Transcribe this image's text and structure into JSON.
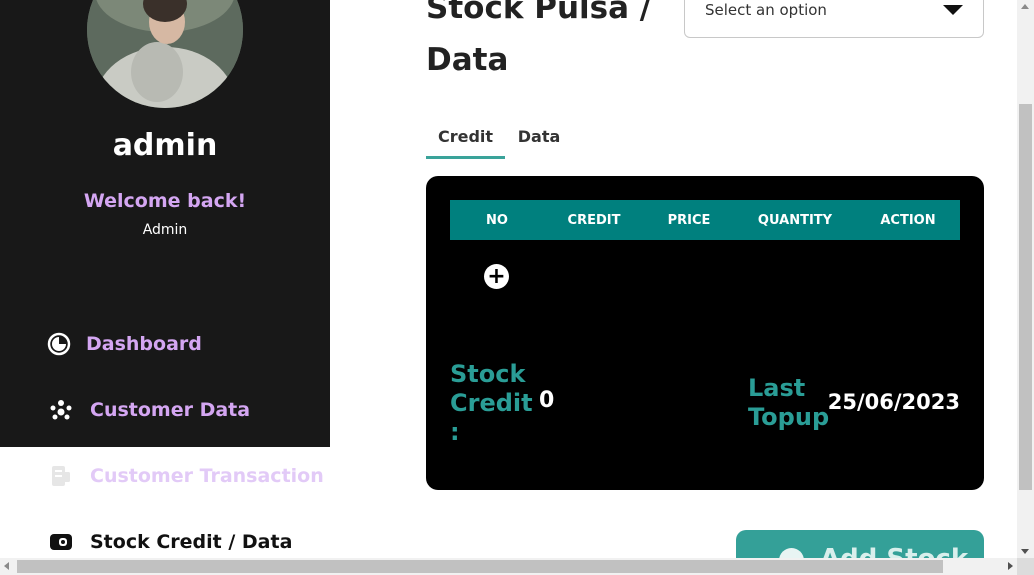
{
  "sidebar": {
    "username": "admin",
    "welcome": "Welcome back!",
    "role": "Admin",
    "items": [
      {
        "label": "Dashboard",
        "icon": "dashboard-icon"
      },
      {
        "label": "Customer Data",
        "icon": "customers-icon"
      },
      {
        "label": "Customer Transaction",
        "icon": "receipt-icon"
      },
      {
        "label": "Stock Credit / Data",
        "icon": "wallet-icon"
      }
    ]
  },
  "main": {
    "title_line1": "Stock Pulsa /",
    "title_line2": "Data",
    "select_placeholder": "Select an option",
    "tabs": [
      {
        "label": "Credit",
        "active": true
      },
      {
        "label": "Data",
        "active": false
      }
    ],
    "table": {
      "headers": [
        "NO",
        "CREDIT",
        "PRICE",
        "QUANTITY",
        "ACTION"
      ],
      "add_row_symbol": "+"
    },
    "stock_credit_label": "Stock Credit :",
    "stock_credit_value": "0",
    "last_topup_label": "Last Topup",
    "last_topup_value": "25/06/2023",
    "add_stock_label": "Add Stock"
  },
  "colors": {
    "accent": "#34a098",
    "table_header": "#00807e",
    "sidebar_bg": "#181818",
    "nav_text": "#d4a6f2"
  }
}
